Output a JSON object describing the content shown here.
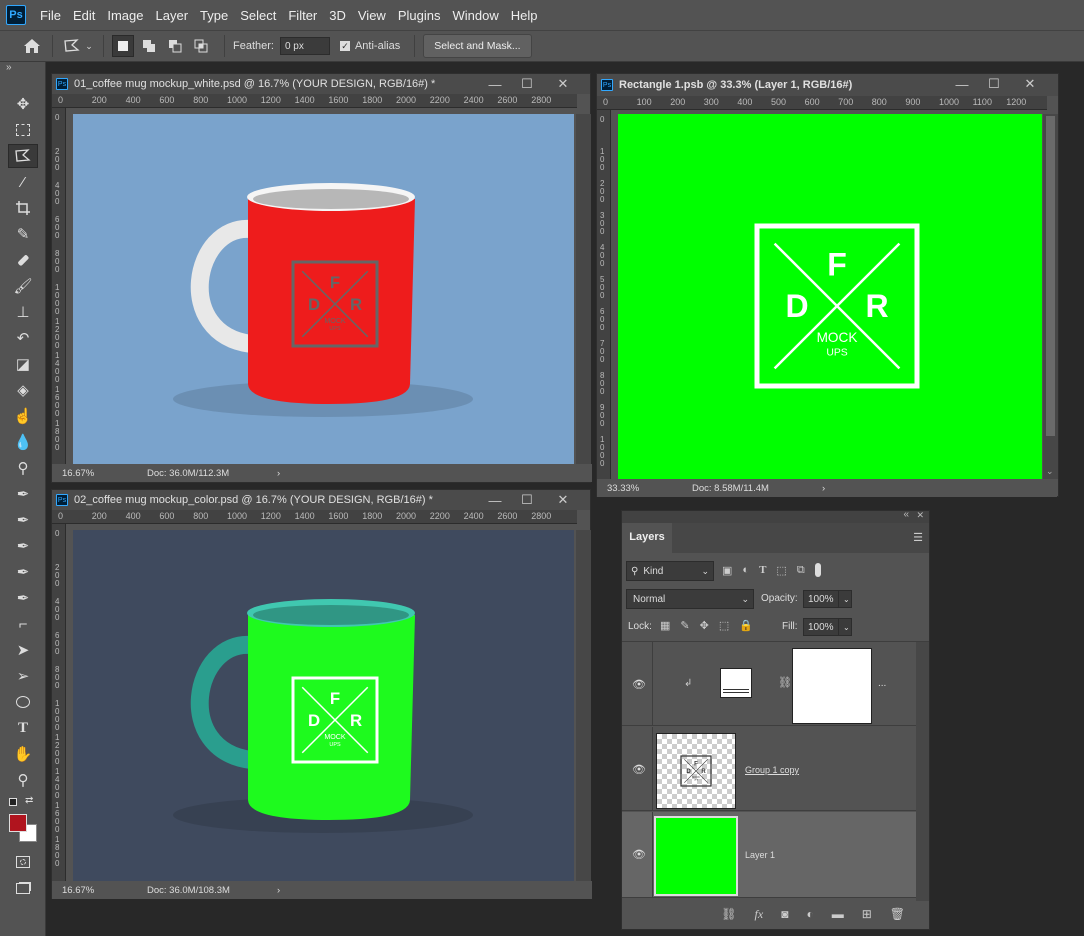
{
  "menu": {
    "logo": "Ps",
    "items": [
      "File",
      "Edit",
      "Image",
      "Layer",
      "Type",
      "Select",
      "Filter",
      "3D",
      "View",
      "Plugins",
      "Window",
      "Help"
    ]
  },
  "options": {
    "feather_label": "Feather:",
    "feather_value": "0 px",
    "antialias_label": "Anti-alias",
    "antialias_checked": true,
    "select_mask_label": "Select and Mask..."
  },
  "toolbar": {
    "expand_label": "»",
    "tools": [
      "move",
      "marquee",
      "polygonal-lasso",
      "magic-wand",
      "crop",
      "eyedropper",
      "healing-brush",
      "brush",
      "clone-stamp",
      "history-brush",
      "eraser",
      "paint-bucket",
      "smudge",
      "blur",
      "dodge",
      "pen",
      "freeform-pen",
      "curvature-pen",
      "add-anchor",
      "delete-anchor",
      "convert-point",
      "path-selection",
      "direct-selection",
      "ellipse",
      "type",
      "hand",
      "zoom"
    ],
    "foreground_color": "#b0141e",
    "background_color": "#ffffff"
  },
  "doc1": {
    "title": "01_coffee mug mockup_white.psd @ 16.7% (YOUR DESIGN, RGB/16#) *",
    "ruler_h": [
      "0",
      "200",
      "400",
      "600",
      "800",
      "1000",
      "1200",
      "1400",
      "1600",
      "1800",
      "2000",
      "2200",
      "2400",
      "2600",
      "2800"
    ],
    "ruler_v": [
      "0",
      "200",
      "400",
      "600",
      "800",
      "1000",
      "1200",
      "1400",
      "1600",
      "1800"
    ],
    "zoom": "16.67%",
    "doc_info": "Doc: 36.0M/112.3M",
    "bg_color": "#7aa3cc",
    "mug_color": "#ee1c1c",
    "logo_color": "#666666"
  },
  "doc2": {
    "title": "02_coffee mug mockup_color.psd @ 16.7% (YOUR DESIGN, RGB/16#) *",
    "ruler_h": [
      "0",
      "200",
      "400",
      "600",
      "800",
      "1000",
      "1200",
      "1400",
      "1600",
      "1800",
      "2000",
      "2200",
      "2400",
      "2600",
      "2800"
    ],
    "ruler_v": [
      "0",
      "200",
      "400",
      "600",
      "800",
      "1000",
      "1200",
      "1400",
      "1600",
      "1800"
    ],
    "zoom": "16.67%",
    "doc_info": "Doc: 36.0M/108.3M",
    "bg_color": "#3f4a5e",
    "mug_color": "#1efa1e",
    "handle_color": "#2a9e8e",
    "logo_color": "#ffffff"
  },
  "doc3": {
    "title": "Rectangle 1.psb @ 33.3% (Layer 1, RGB/16#)",
    "ruler_h": [
      "0",
      "100",
      "200",
      "300",
      "400",
      "500",
      "600",
      "700",
      "800",
      "900",
      "1000",
      "1100",
      "1200"
    ],
    "ruler_v": [
      "0",
      "100",
      "200",
      "300",
      "400",
      "500",
      "600",
      "700",
      "800",
      "900",
      "1000"
    ],
    "zoom": "33.33%",
    "doc_info": "Doc: 8.58M/11.4M",
    "bg_color": "#00ff00",
    "logo_color": "#ffffff"
  },
  "logo_text": {
    "f": "F",
    "d": "D",
    "r": "R",
    "mock": "MOCK",
    "ups": "UPS"
  },
  "layers_panel": {
    "tab": "Layers",
    "filter_kind": "Kind",
    "blend_mode": "Normal",
    "opacity_label": "Opacity:",
    "opacity_value": "100%",
    "lock_label": "Lock:",
    "fill_label": "Fill:",
    "fill_value": "100%",
    "layers": [
      {
        "name": "",
        "more": "...",
        "selected": false
      },
      {
        "name": "Group 1 copy",
        "selected": false
      },
      {
        "name": "Layer 1",
        "selected": true,
        "thumb_color": "#00ff00"
      }
    ]
  }
}
